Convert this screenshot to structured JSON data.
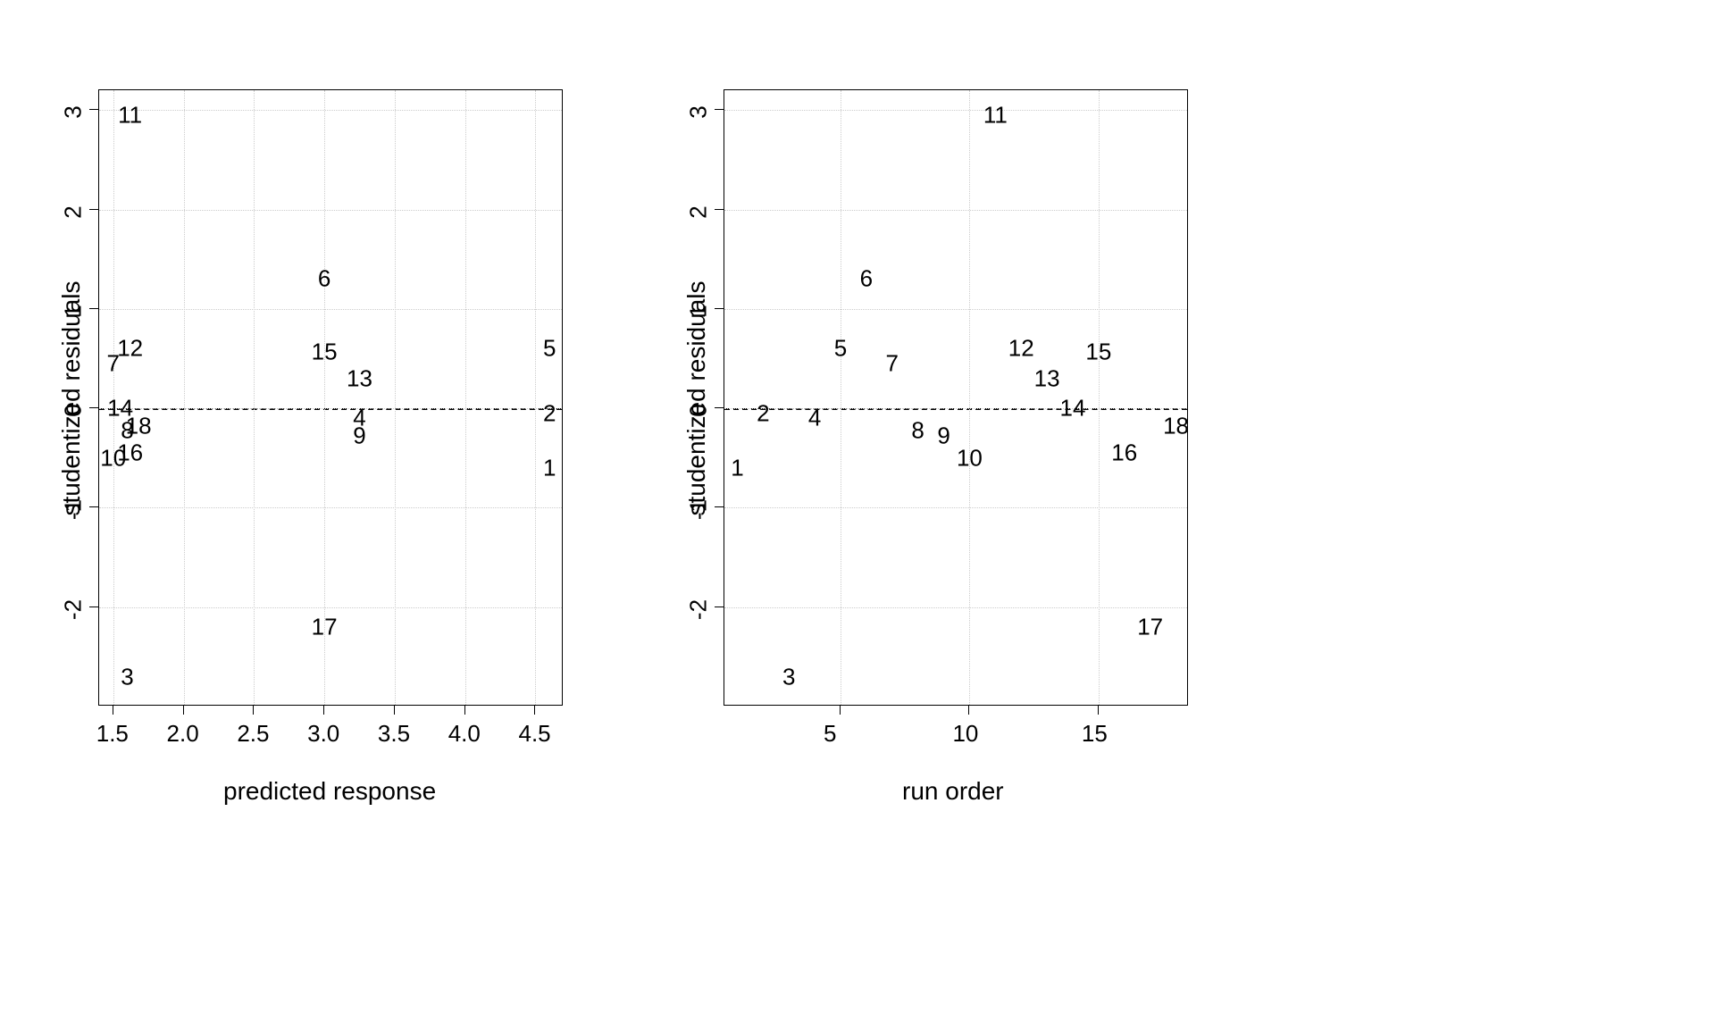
{
  "chart_data": [
    {
      "type": "scatter",
      "xlabel": "predicted response",
      "ylabel": "studentized residuals",
      "title": "",
      "xlim": [
        1.4,
        4.7
      ],
      "ylim": [
        -3.0,
        3.2
      ],
      "x_ticks": [
        1.5,
        2.0,
        2.5,
        3.0,
        3.5,
        4.0,
        4.5
      ],
      "y_ticks": [
        -2,
        -1,
        0,
        1,
        2,
        3
      ],
      "series": [
        {
          "name": "residuals",
          "points": [
            {
              "label": "1",
              "x": 4.6,
              "y": -0.6
            },
            {
              "label": "2",
              "x": 4.6,
              "y": -0.05
            },
            {
              "label": "3",
              "x": 1.6,
              "y": -2.7
            },
            {
              "label": "4",
              "x": 3.25,
              "y": -0.1
            },
            {
              "label": "5",
              "x": 4.6,
              "y": 0.6
            },
            {
              "label": "6",
              "x": 3.0,
              "y": 1.3
            },
            {
              "label": "7",
              "x": 1.5,
              "y": 0.45
            },
            {
              "label": "8",
              "x": 1.6,
              "y": -0.22
            },
            {
              "label": "9",
              "x": 3.25,
              "y": -0.28
            },
            {
              "label": "10",
              "x": 1.5,
              "y": -0.5
            },
            {
              "label": "11",
              "x": 1.62,
              "y": 2.95
            },
            {
              "label": "12",
              "x": 1.62,
              "y": 0.6
            },
            {
              "label": "13",
              "x": 3.25,
              "y": 0.3
            },
            {
              "label": "14",
              "x": 1.55,
              "y": 0.0
            },
            {
              "label": "15",
              "x": 3.0,
              "y": 0.57
            },
            {
              "label": "16",
              "x": 1.62,
              "y": -0.45
            },
            {
              "label": "17",
              "x": 3.0,
              "y": -2.2
            },
            {
              "label": "18",
              "x": 1.68,
              "y": -0.18
            }
          ]
        }
      ],
      "hline": 0
    },
    {
      "type": "scatter",
      "xlabel": "run order",
      "ylabel": "studentized residuals",
      "title": "",
      "xlim": [
        0.5,
        18.5
      ],
      "ylim": [
        -3.0,
        3.2
      ],
      "x_ticks": [
        5,
        10,
        15
      ],
      "y_ticks": [
        -2,
        -1,
        0,
        1,
        2,
        3
      ],
      "series": [
        {
          "name": "residuals",
          "points": [
            {
              "label": "1",
              "x": 1,
              "y": -0.6
            },
            {
              "label": "2",
              "x": 2,
              "y": -0.05
            },
            {
              "label": "3",
              "x": 3,
              "y": -2.7
            },
            {
              "label": "4",
              "x": 4,
              "y": -0.1
            },
            {
              "label": "5",
              "x": 5,
              "y": 0.6
            },
            {
              "label": "6",
              "x": 6,
              "y": 1.3
            },
            {
              "label": "7",
              "x": 7,
              "y": 0.45
            },
            {
              "label": "8",
              "x": 8,
              "y": -0.22
            },
            {
              "label": "9",
              "x": 9,
              "y": -0.28
            },
            {
              "label": "10",
              "x": 10,
              "y": -0.5
            },
            {
              "label": "11",
              "x": 11,
              "y": 2.95
            },
            {
              "label": "12",
              "x": 12,
              "y": 0.6
            },
            {
              "label": "13",
              "x": 13,
              "y": 0.3
            },
            {
              "label": "14",
              "x": 14,
              "y": 0.0
            },
            {
              "label": "15",
              "x": 15,
              "y": 0.57
            },
            {
              "label": "16",
              "x": 16,
              "y": -0.45
            },
            {
              "label": "17",
              "x": 17,
              "y": -2.2
            },
            {
              "label": "18",
              "x": 18,
              "y": -0.18
            }
          ]
        }
      ],
      "hline": 0
    }
  ],
  "left": {
    "xlabel": "predicted response",
    "ylabel": "studentized residuals"
  },
  "right": {
    "xlabel": "run order",
    "ylabel": "studentized residuals"
  }
}
